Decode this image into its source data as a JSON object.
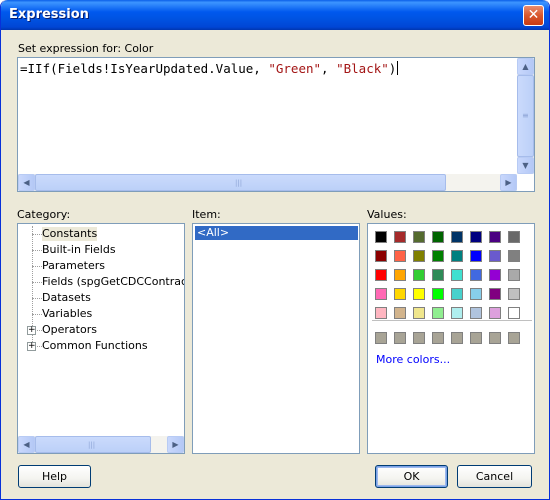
{
  "window": {
    "title": "Expression",
    "close_glyph": "✕"
  },
  "expression": {
    "label": "Set expression for: Color",
    "prefix": "=IIf(Fields!IsYearUpdated.Value, ",
    "str1": "\"Green\"",
    "sep": ", ",
    "str2": "\"Black\"",
    "suffix": ")"
  },
  "category": {
    "label": "Category:",
    "items": [
      {
        "label": "Constants",
        "selected": true,
        "expandable": false
      },
      {
        "label": "Built-in Fields",
        "expandable": false
      },
      {
        "label": "Parameters",
        "expandable": false
      },
      {
        "label": "Fields (spgGetCDCContractHi",
        "expandable": false
      },
      {
        "label": "Datasets",
        "expandable": false
      },
      {
        "label": "Variables",
        "expandable": false
      },
      {
        "label": "Operators",
        "expandable": true,
        "expander": "+"
      },
      {
        "label": "Common Functions",
        "expandable": true,
        "expander": "+"
      }
    ]
  },
  "item": {
    "label": "Item:",
    "items": [
      {
        "label": "<All>",
        "selected": true
      }
    ]
  },
  "values": {
    "label": "Values:",
    "colors": [
      [
        "#000000",
        "#A52A2A",
        "#556B2F",
        "#006400",
        "#003366",
        "#000080",
        "#4B0082",
        "#696969"
      ],
      [
        "#8B0000",
        "#FF6347",
        "#808000",
        "#008000",
        "#008080",
        "#0000FF",
        "#6A5ACD",
        "#808080"
      ],
      [
        "#FF0000",
        "#FFA500",
        "#32CD32",
        "#2E8B57",
        "#40E0D0",
        "#4169E1",
        "#9400D3",
        "#A9A9A9"
      ],
      [
        "#FF69B4",
        "#FFD700",
        "#FFFF00",
        "#00FF00",
        "#48D1CC",
        "#87CEEB",
        "#800080",
        "#C0C0C0"
      ],
      [
        "#FFB6C1",
        "#D2B48C",
        "#F0E68C",
        "#90EE90",
        "#AFEEEE",
        "#B0C4DE",
        "#DDA0DD",
        "#FFFFFF"
      ]
    ],
    "custom_colors": [
      "#A8A496",
      "#A8A496",
      "#A8A496",
      "#A8A496",
      "#A8A496",
      "#A8A496",
      "#A8A496",
      "#A8A496"
    ],
    "more_colors": "More colors..."
  },
  "buttons": {
    "help": "Help",
    "ok": "OK",
    "cancel": "Cancel"
  },
  "icons": {
    "scroll_up": "▲",
    "scroll_down": "▼",
    "scroll_left": "◀",
    "scroll_right": "▶",
    "grip_v": "≡",
    "grip_h": "|||"
  }
}
